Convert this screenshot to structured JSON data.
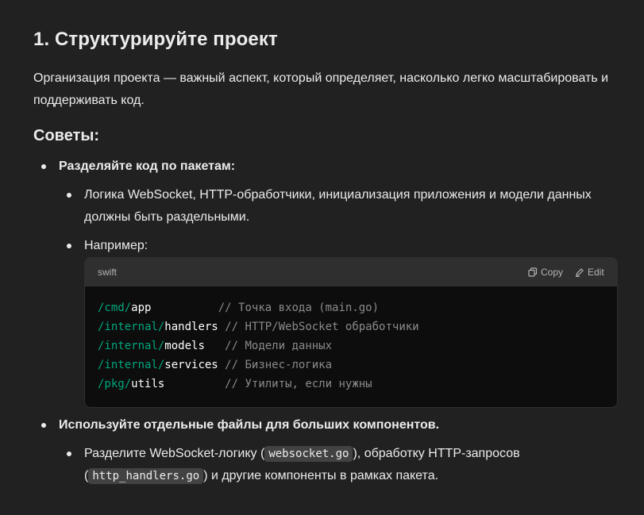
{
  "heading": "1. Структурируйте проект",
  "intro": "Организация проекта — важный аспект, который определяет, насколько легко масштабировать и поддерживать код.",
  "tips_heading": "Советы:",
  "bullets": {
    "split_packages": "Разделяйте код по пакетам:",
    "logic_separate": "Логика WebSocket, HTTP-обработчики, инициализация приложения и модели данных должны быть раздельными.",
    "example": "Например:",
    "separate_files": "Используйте отдельные файлы для больших компонентов.",
    "split_part1": "Разделите WebSocket-логику (",
    "split_code1": "websocket.go",
    "split_part2": "), обработку HTTP-запросов",
    "split_part3": "(",
    "split_code2": "http_handlers.go",
    "split_part4": ") и другие компоненты в рамках пакета."
  },
  "code_block": {
    "language": "swift",
    "copy_label": "Copy",
    "edit_label": "Edit",
    "lines": [
      {
        "path": "/cmd/",
        "name": "app",
        "pad": "          ",
        "comment": "// Точка входа (main.go)"
      },
      {
        "path": "/internal/",
        "name": "handlers",
        "pad": " ",
        "comment": "// HTTP/WebSocket обработчики"
      },
      {
        "path": "/internal/",
        "name": "models",
        "pad": "   ",
        "comment": "// Модели данных"
      },
      {
        "path": "/internal/",
        "name": "services",
        "pad": " ",
        "comment": "// Бизнес-логика"
      },
      {
        "path": "/pkg/",
        "name": "utils",
        "pad": "         ",
        "comment": "// Утилиты, если нужны"
      }
    ]
  }
}
